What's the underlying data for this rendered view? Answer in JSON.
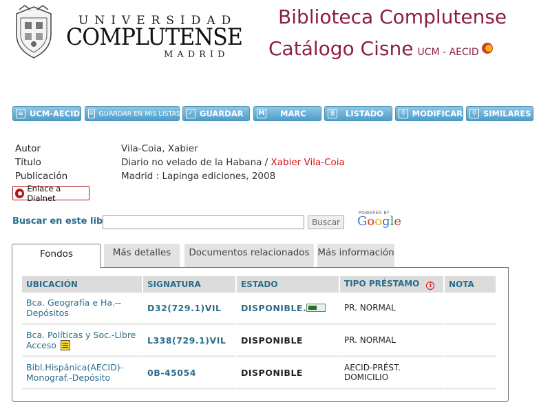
{
  "header": {
    "uni_top": "UNIVERSIDAD",
    "uni_name": "COMPLUTENSE",
    "uni_city": "MADRID",
    "title_line1": "Biblioteca Complutense",
    "title_line2": "Catálogo Cisne",
    "title_sub": "UCM - AECID"
  },
  "toolbar": [
    {
      "label": "UCM-AECID",
      "icon": "home-icon"
    },
    {
      "label": "GUARDAR EN MIS LISTAS",
      "icon": "list-save-icon"
    },
    {
      "label": "GUARDAR",
      "icon": "check-icon"
    },
    {
      "label": "MARC",
      "icon": "marc-icon"
    },
    {
      "label": "LISTADO",
      "icon": "list-icon"
    },
    {
      "label": "MODIFICAR",
      "icon": "search-modify-icon"
    },
    {
      "label": "SIMILARES",
      "icon": "search-similar-icon"
    }
  ],
  "record": {
    "autor_label": "Autor",
    "autor_value": "Vila-Coia, Xabier",
    "titulo_label": "Título",
    "titulo_value": "Diario no velado de la Habana / ",
    "titulo_author": "Xabier Vila-Coia",
    "pub_label": "Publicación",
    "pub_value": "Madrid : Lapinga ediciones, 2008"
  },
  "dialnet_label": "Enlace a Dialnet",
  "search": {
    "label": "Buscar en este libro:",
    "value": "",
    "button": "Buscar",
    "powered": "POWERED BY"
  },
  "tabs": [
    "Fondos",
    "Más detalles",
    "Documentos relacionados",
    "Más información"
  ],
  "holdings": {
    "headers": [
      "UBICACIÓN",
      "SIGNATURA",
      "ESTADO",
      "TIPO PRÉSTAMO",
      "NOTA"
    ],
    "rows": [
      {
        "ubicacion": "Bca. Geografía e Ha.-- Depósitos",
        "signatura": "D32(729.1)VIL",
        "estado": "DISPONIBLE.",
        "tipo": "PR. NORMAL",
        "nota": ""
      },
      {
        "ubicacion": "Bca. Políticas y Soc.-Libre Acceso",
        "signatura": "L338(729.1)VIL",
        "estado": "DISPONIBLE",
        "tipo": "PR. NORMAL",
        "nota": ""
      },
      {
        "ubicacion": "Bibl.Hispánica(AECID)-Monograf.-Depósito",
        "signatura": "0B-45054",
        "estado": "DISPONIBLE",
        "tipo": "AECID-PRÉST. DOMICILIO",
        "nota": ""
      }
    ]
  }
}
